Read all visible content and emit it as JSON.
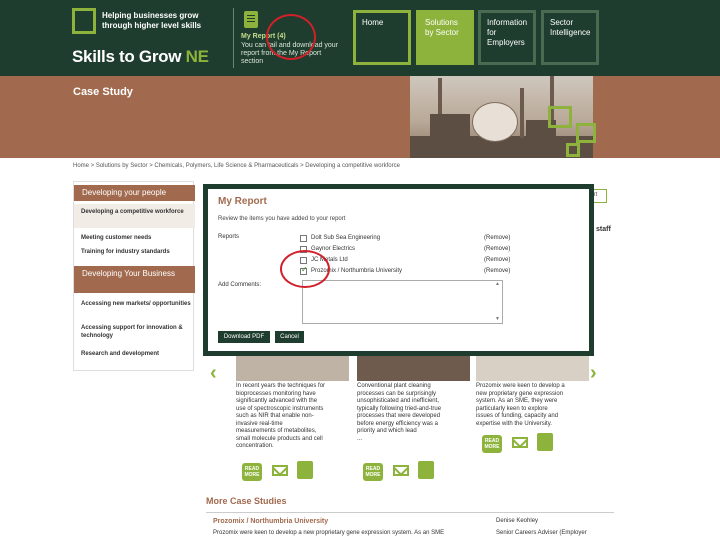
{
  "header": {
    "tagline": [
      "Helping businesses grow",
      "through higher level skills"
    ],
    "logo_main": "Skills to Grow ",
    "logo_ne": "NE",
    "my_report": "My Report (4)",
    "my_report_desc": [
      "You can tail and download your",
      "report from the My Report",
      "section"
    ]
  },
  "nav": {
    "home": "Home",
    "solutions": "Solutions by Sector",
    "information": "Information for Employers",
    "sector": "Sector Intelligence"
  },
  "banner": {
    "title": "Case Study"
  },
  "breadcrumb": "Home > Solutions by Sector > Chemicals, Polymers, Life Science & Pharmaceuticals > Developing a competitive workforce",
  "sidebar": {
    "head1": "Developing your people",
    "items1": [
      "Developing a competitive workforce",
      "Meeting customer needs",
      "Training for industry standards"
    ],
    "head2": "Developing Your Business",
    "items2": [
      "Accessing new markets/ opportunities",
      "Accessing support for innovation & technology",
      "Research and development"
    ]
  },
  "background": {
    "right_btn": "port",
    "right_text": "staff",
    "cases": [
      [
        "In recent years the techniques for",
        "bioprocesses monitoring have",
        "significantly advanced with the",
        "use of spectroscopic instruments",
        "such as NIR that enable non-",
        "invasive real-time",
        "measurements of metabolites,",
        "small molecule products and cell",
        "concentration."
      ],
      [
        "Conventional plant cleaning",
        "processes can be surprisingly",
        "unsophisticated and inefficient,",
        "typically following tried-and-true",
        "processes that were developed",
        "before energy efficiency was a",
        "priority and which lead",
        "..."
      ],
      [
        "Prozomix were keen to develop a",
        "new proprietary gene expression",
        "system. As an SME, they were",
        "particularly keen to explore",
        "issues of funding, capacity and",
        "expertise with the University."
      ]
    ],
    "read_more": "READ MORE",
    "more_title": "More Case Studies",
    "more_item_title": "Prozomix / Northumbria University",
    "more_item_text": "Prozomix were keen to develop a new proprietary gene expression system. As an SME",
    "contact_name": "Denise Keohley",
    "contact_role": "Senior Careers Adviser (Employer"
  },
  "modal": {
    "title": "My Report",
    "desc": "Review the items you have added to your report",
    "reports_label": "Reports",
    "reports": [
      {
        "name": "Dolt Sub Sea Engineering",
        "checked": false
      },
      {
        "name": "Gaynor Electrics",
        "checked": false
      },
      {
        "name": "JC Metals Ltd",
        "checked": false
      },
      {
        "name": "Prozomix / Northumbria University",
        "checked": true
      }
    ],
    "remove_label": "(Remove)",
    "comments_label": "Add Comments:",
    "comments_value": "",
    "download_label": "Download PDF",
    "cancel_label": "Cancel"
  },
  "colors": {
    "header_bg": "#1e3d2e",
    "accent_green": "#8db33c",
    "banner_brown": "#a16a4e",
    "annotation_red": "#d0202a"
  },
  "icons": [
    "report-icon",
    "mail-icon",
    "add-to-report-icon",
    "chevron-left-icon",
    "chevron-right-icon"
  ]
}
